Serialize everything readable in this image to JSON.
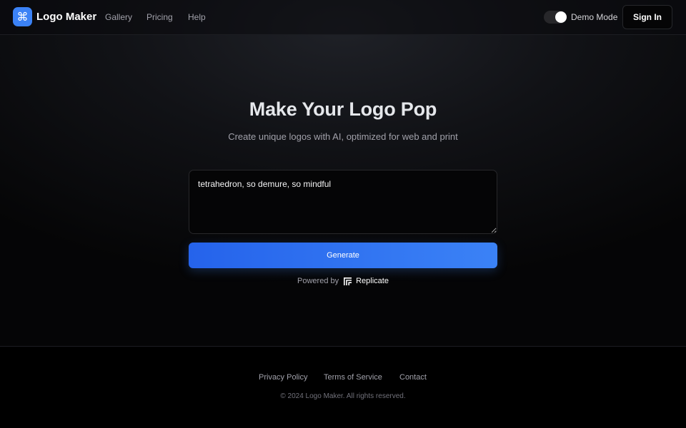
{
  "header": {
    "brand": "Logo Maker",
    "logo_icon": "command-icon",
    "nav": [
      {
        "label": "Gallery"
      },
      {
        "label": "Pricing"
      },
      {
        "label": "Help"
      }
    ],
    "demo_mode": {
      "label": "Demo Mode",
      "enabled": true
    },
    "sign_in_label": "Sign In"
  },
  "hero": {
    "title": "Make Your Logo Pop",
    "subtitle": "Create unique logos with AI, optimized for web and print"
  },
  "prompt": {
    "value": "tetrahedron, so demure, so mindful"
  },
  "generate_label": "Generate",
  "powered_by": {
    "prefix": "Powered by",
    "provider": "Replicate",
    "icon": "replicate-icon"
  },
  "footer": {
    "links": [
      {
        "label": "Privacy Policy"
      },
      {
        "label": "Terms of Service"
      },
      {
        "label": "Contact"
      }
    ],
    "copyright": "© 2024 Logo Maker. All rights reserved."
  },
  "colors": {
    "accent": "#3b82f6",
    "background": "#000000"
  }
}
